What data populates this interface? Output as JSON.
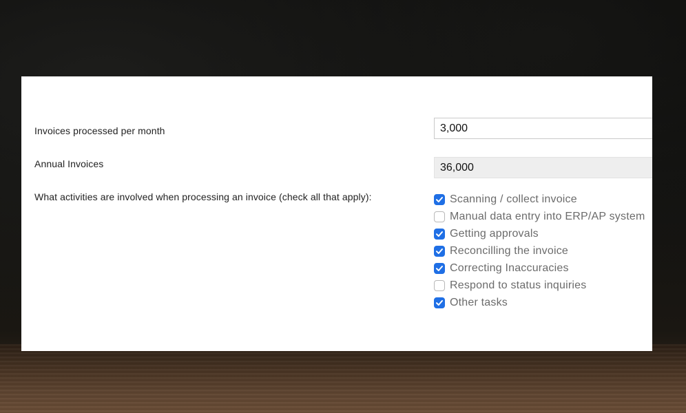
{
  "form": {
    "invoices_per_month": {
      "label": "Invoices processed per month",
      "value": "3,000"
    },
    "annual_invoices": {
      "label": "Annual Invoices",
      "value": "36,000"
    },
    "activities": {
      "label": "What activities are involved when processing an invoice (check all that apply):",
      "options": [
        {
          "label": "Scanning / collect invoice",
          "checked": true
        },
        {
          "label": "Manual data entry into ERP/AP system",
          "checked": false
        },
        {
          "label": "Getting approvals",
          "checked": true
        },
        {
          "label": "Reconcilling the invoice",
          "checked": true
        },
        {
          "label": "Correcting Inaccuracies",
          "checked": true
        },
        {
          "label": "Respond to status inquiries",
          "checked": false
        },
        {
          "label": "Other tasks",
          "checked": true
        }
      ]
    }
  },
  "colors": {
    "checkbox_accent": "#1f6fe5"
  }
}
